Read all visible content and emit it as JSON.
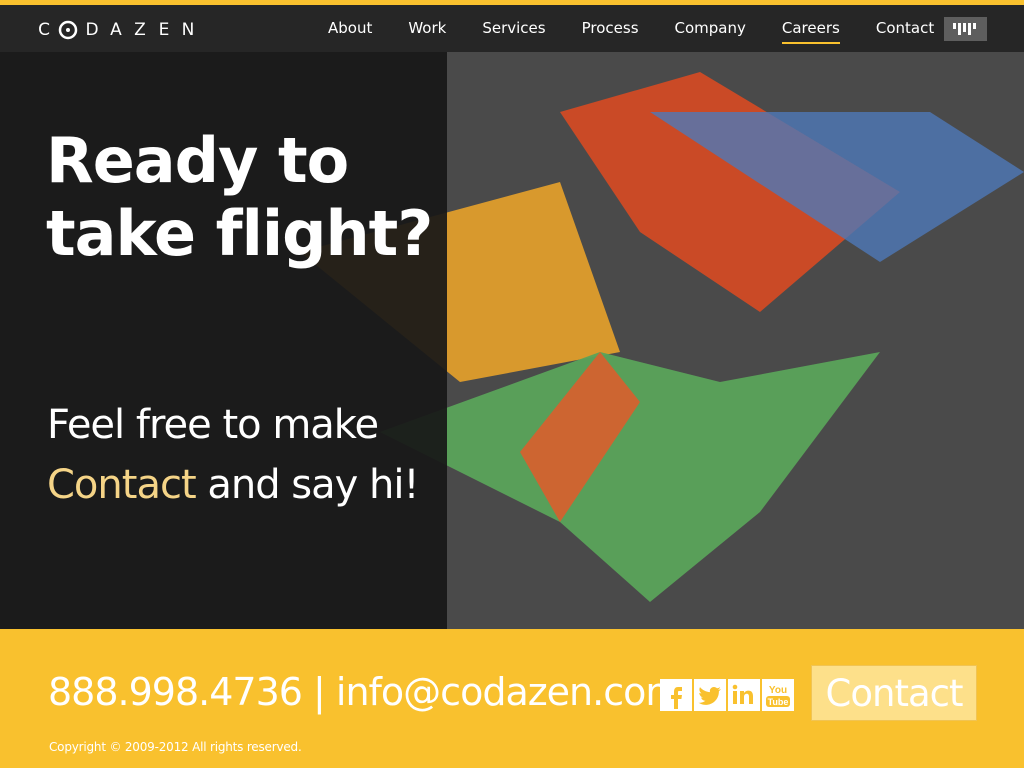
{
  "brand": {
    "letters": [
      "C",
      "D",
      "A",
      "Z",
      "E",
      "N"
    ],
    "accent_color": "#f9c12e",
    "highlight_color": "#f5d487"
  },
  "nav": {
    "items": [
      {
        "label": "About"
      },
      {
        "label": "Work"
      },
      {
        "label": "Services"
      },
      {
        "label": "Process"
      },
      {
        "label": "Company"
      },
      {
        "label": "Careers",
        "active": true
      },
      {
        "label": "Contact"
      }
    ],
    "menu_icon": "bars-menu-icon"
  },
  "hero": {
    "headline_line1": "Ready to",
    "headline_line2": "take flight?",
    "tagline_line1": "Feel free to make",
    "tagline_link": "Contact",
    "tagline_rest": " and say hi!"
  },
  "footer": {
    "phone": "888.998.4736",
    "separator": " | ",
    "email": "info@codazen.com",
    "social": [
      "facebook-icon",
      "twitter-icon",
      "linkedin-icon",
      "youtube-icon"
    ],
    "contact_button": "Contact",
    "copyright": "Copyright © 2009-2012  All rights reserved."
  }
}
